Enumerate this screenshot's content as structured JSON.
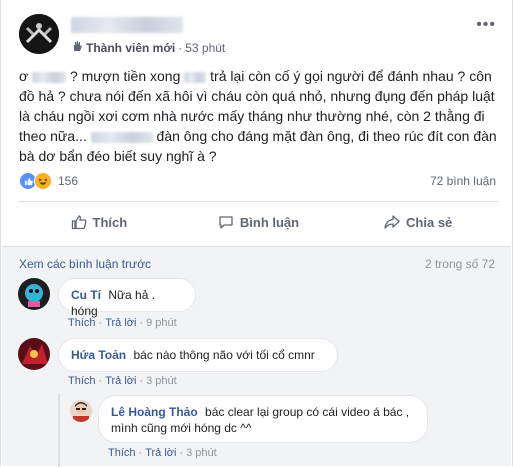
{
  "post": {
    "author_role": "Thành viên mới",
    "time": "53 phút",
    "dot": "·",
    "text_segments": [
      "ơ",
      "? mượn tiền xong",
      "trả lại còn cố ý gọi người để đánh nhau ?",
      "côn đồ hả ? chưa nói đến xã hôi vì cháu còn quá nhỏ, nhưng đụng đến pháp luật là cháu ngồi xơi cơm nhà nước mấy tháng như thường nhé, còn 2 thằng đi theo nữa...",
      "đàn ông cho đáng mặt đàn ông, đi theo rúc đít con đàn bà dơ bẩn đéo biết suy nghĩ à ?"
    ],
    "reaction_count": "156",
    "comment_count": "72 bình luận"
  },
  "actions": {
    "like": "Thích",
    "comment": "Bình luận",
    "share": "Chia sẻ"
  },
  "comments_section": {
    "view_previous": "Xem các bình luận trước",
    "counter": "2 trong số 72",
    "like_label": "Thích",
    "reply_label": "Trả lời",
    "items": [
      {
        "name": "Cu Tí",
        "text": "Nữa hả . hóng",
        "time": "9 phút"
      },
      {
        "name": "Hứa Toản",
        "text": "bác nào thông não với tối cổ cmnr",
        "time": "3 phút"
      }
    ],
    "reply": {
      "name": "Lê Hoàng Thảo",
      "text": "bác clear lại group có cái video á bác , mình cũng mới hóng dc ^^",
      "time": "3 phút"
    }
  }
}
